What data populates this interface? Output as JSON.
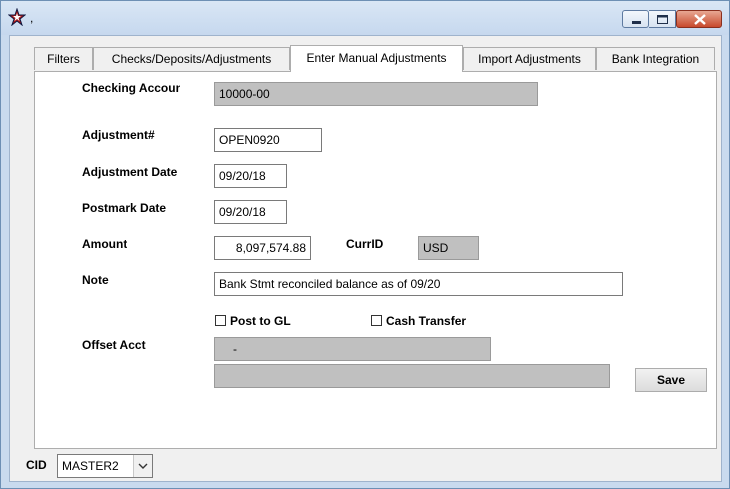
{
  "window": {
    "title": ","
  },
  "tabs": [
    {
      "label": "Filters"
    },
    {
      "label": "Checks/Deposits/Adjustments"
    },
    {
      "label": "Enter Manual Adjustments"
    },
    {
      "label": "Import Adjustments"
    },
    {
      "label": "Bank Integration"
    }
  ],
  "form": {
    "checking_account_label": "Checking Accoun",
    "checking_account_value": "10000-00",
    "adjustment_no_label": "Adjustment#",
    "adjustment_no_value": "OPEN0920",
    "adjustment_date_label": "Adjustment Date",
    "adjustment_date_value": "09/20/18",
    "postmark_date_label": "Postmark Date",
    "postmark_date_value": "09/20/18",
    "amount_label": "Amount",
    "amount_value": "8,097,574.88",
    "currid_label": "CurrID",
    "currid_value": "USD",
    "note_label": "Note",
    "note_value": "Bank Stmt reconciled balance as of 09/20",
    "post_to_gl_label": "Post to GL",
    "post_to_gl_checked": false,
    "cash_transfer_label": "Cash Transfer",
    "cash_transfer_checked": false,
    "offset_acct_label": "Offset Acct",
    "offset_acct_value": "-",
    "offset_acct_desc": "",
    "save_label": "Save"
  },
  "footer": {
    "cid_label": "CID",
    "cid_value": "MASTER2"
  }
}
